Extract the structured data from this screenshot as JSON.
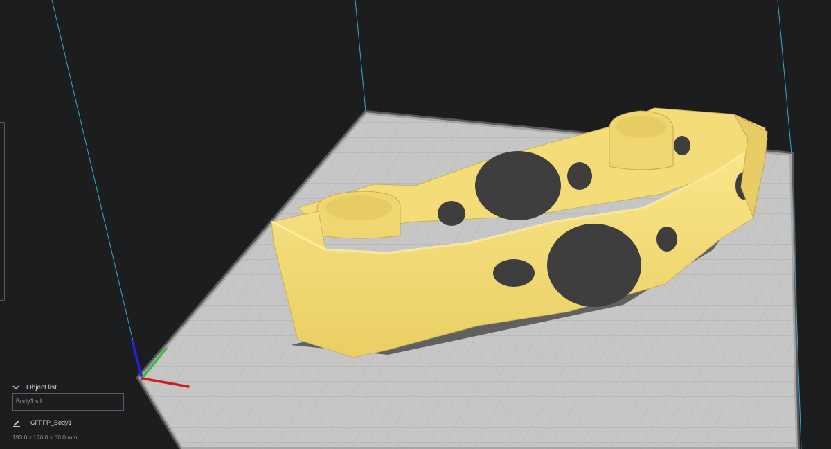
{
  "object_list": {
    "header": "Object list",
    "chevron_icon": "chevron-down-icon",
    "items": [
      "Body1.stl"
    ]
  },
  "job": {
    "edit_icon": "pencil-icon",
    "name": "CFFFP_Body1"
  },
  "model": {
    "dimensions": "193.0 x 176.0 x 50.0 mm",
    "color": "#f6df7b"
  },
  "viewport": {
    "background": "#1c1d1f",
    "build_plate_color": "#c7c7c7",
    "volume_edge_color": "#39a9d6",
    "axis_colors": {
      "x": "#d21d1d",
      "y": "#3fb94a",
      "z": "#2424d6"
    }
  }
}
